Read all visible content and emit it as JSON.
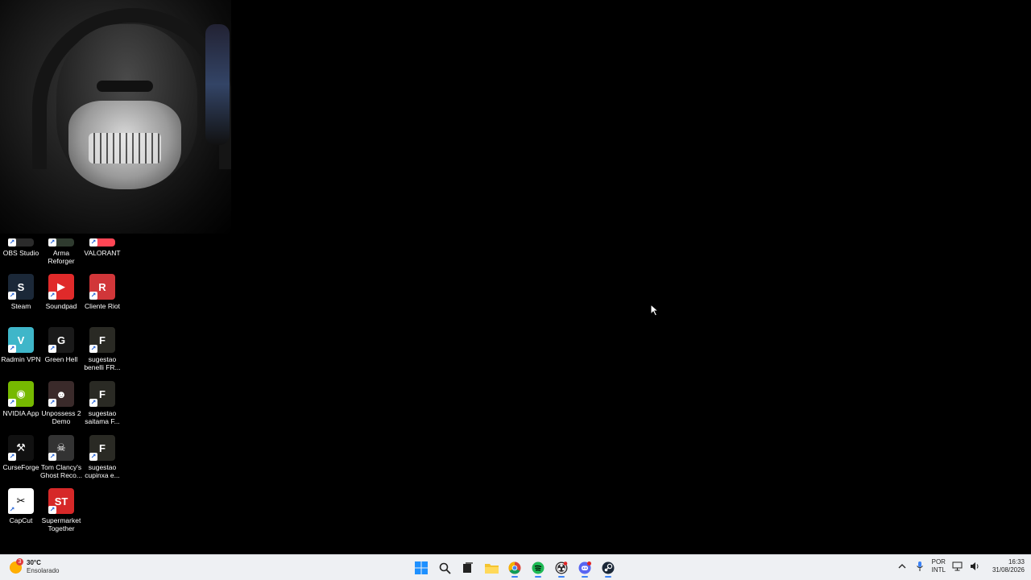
{
  "desktop_icons": [
    {
      "label": "OBS Studio",
      "color": "#2b2b2b",
      "glyph": ""
    },
    {
      "label": "Arma Reforger",
      "color": "#2f3b2f",
      "glyph": ""
    },
    {
      "label": "VALORANT",
      "color": "#ff4655",
      "glyph": ""
    },
    {
      "label": "Steam",
      "color": "#1b2838",
      "glyph": "S"
    },
    {
      "label": "Soundpad",
      "color": "#e02a2a",
      "glyph": "▶"
    },
    {
      "label": "Cliente Riot",
      "color": "#d13639",
      "glyph": "R"
    },
    {
      "label": "Radmin VPN",
      "color": "#3fb6c9",
      "glyph": "V"
    },
    {
      "label": "Green Hell",
      "color": "#1a1a1a",
      "glyph": "G"
    },
    {
      "label": "sugestao benelli FR...",
      "color": "#2a2a24",
      "glyph": "F"
    },
    {
      "label": "NVIDIA App",
      "color": "#76b900",
      "glyph": "◉"
    },
    {
      "label": "Unpossess 2 Demo",
      "color": "#3a2a2a",
      "glyph": "☻"
    },
    {
      "label": "sugestao saitama F...",
      "color": "#2a2a24",
      "glyph": "F"
    },
    {
      "label": "CurseForge",
      "color": "#111111",
      "glyph": "⚒"
    },
    {
      "label": "Tom Clancy's Ghost Reco...",
      "color": "#333333",
      "glyph": "☠"
    },
    {
      "label": "sugestao cupinxa e...",
      "color": "#2a2a24",
      "glyph": "F"
    },
    {
      "label": "CapCut",
      "color": "#ffffff",
      "glyph": "✂"
    },
    {
      "label": "Supermarket Together",
      "color": "#d62828",
      "glyph": "ST"
    }
  ],
  "taskbar": {
    "weather": {
      "temp": "30°C",
      "desc": "Ensolarado",
      "badge": "3"
    },
    "apps": [
      {
        "name": "start-button",
        "icon": "windows-logo"
      },
      {
        "name": "search-button",
        "icon": "search-icon"
      },
      {
        "name": "task-view-button",
        "icon": "task-view-icon"
      },
      {
        "name": "file-explorer-button",
        "icon": "folder-icon"
      },
      {
        "name": "chrome-button",
        "icon": "chrome-icon"
      },
      {
        "name": "spotify-button",
        "icon": "spotify-icon"
      },
      {
        "name": "obs-button",
        "icon": "obs-icon"
      },
      {
        "name": "discord-button",
        "icon": "discord-icon"
      },
      {
        "name": "steam-button",
        "icon": "steam-icon"
      }
    ],
    "lang_top": "POR",
    "lang_bottom": "INTL",
    "time": "16:33",
    "date": "31/08/2026"
  }
}
